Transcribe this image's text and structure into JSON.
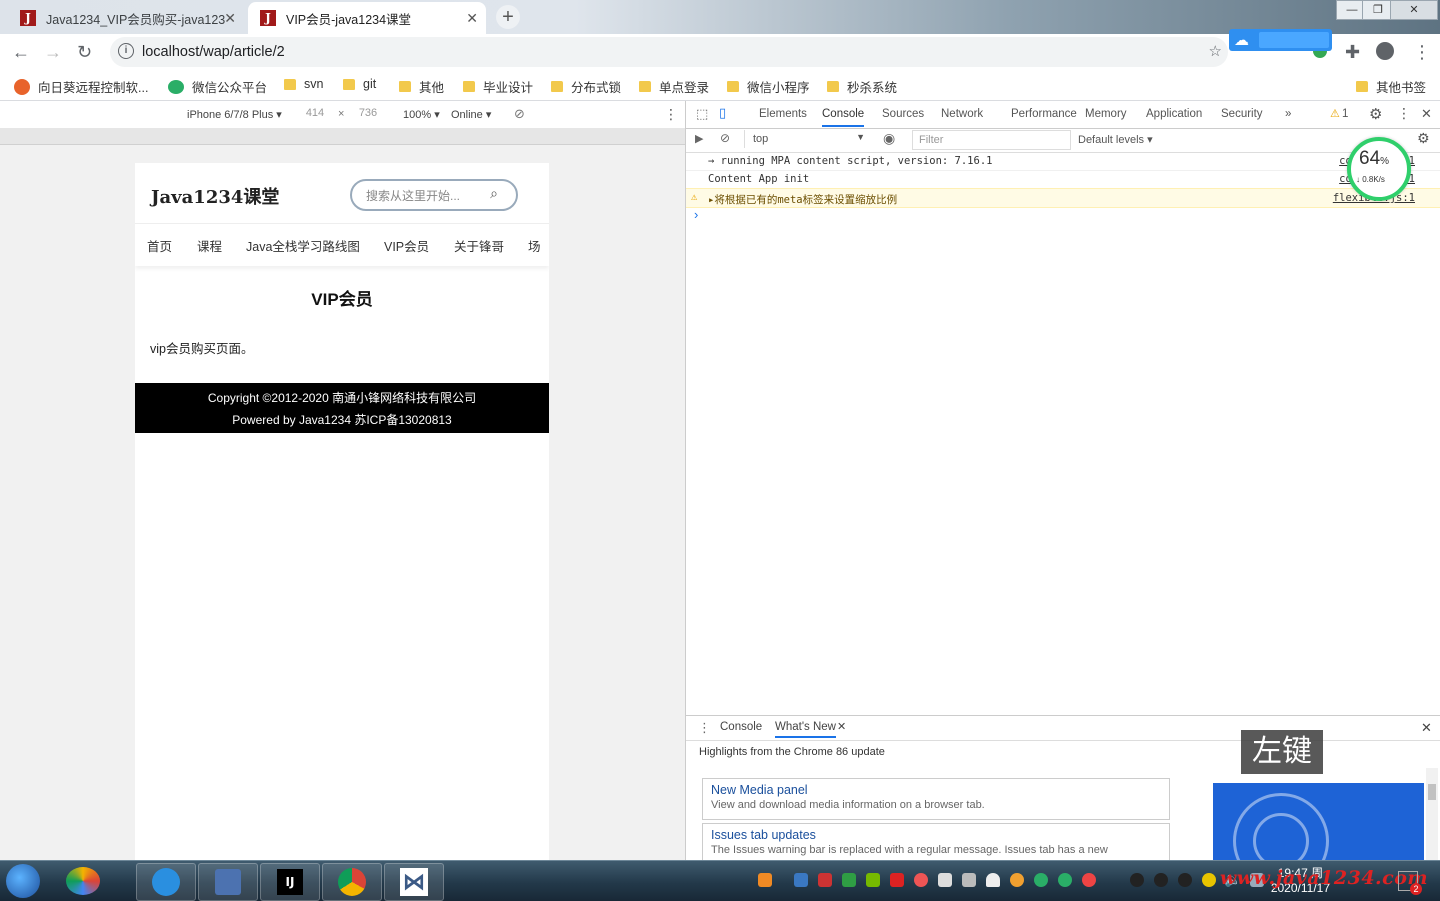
{
  "browser": {
    "tabs": [
      {
        "label": "Java1234_VIP会员购买-java123",
        "favicon": "J"
      },
      {
        "label": "VIP会员-java1234课堂",
        "favicon": "J"
      }
    ],
    "url": "localhost/wap/article/2",
    "bookmarks": [
      "向日葵远程控制软...",
      "微信公众平台",
      "svn",
      "git",
      "其他",
      "毕业设计",
      "分布式锁",
      "单点登录",
      "微信小程序",
      "秒杀系统"
    ],
    "other_bookmarks": "其他书签"
  },
  "device_toolbar": {
    "device": "iPhone 6/7/8 Plus ▾",
    "width": "414",
    "times": "×",
    "height": "736",
    "zoom": "100% ▾",
    "network": "Online ▾"
  },
  "mobile_page": {
    "site_title": "Java1234课堂",
    "search_placeholder": "搜索从这里开始...",
    "nav": [
      "首页",
      "课程",
      "Java全栈学习路线图",
      "VIP会员",
      "关于锋哥",
      "场"
    ],
    "article_title": "VIP会员",
    "article_body": "vip会员购买页面。",
    "footer_line1": "Copyright ©2012-2020 南通小锋网络科技有限公司",
    "footer_line2": "Powered by Java1234 苏ICP备13020813"
  },
  "devtools": {
    "tabs": [
      "Elements",
      "Console",
      "Sources",
      "Network",
      "Performance",
      "Memory",
      "Application",
      "Security",
      "»"
    ],
    "active_tab": "Console",
    "warning_count": "1",
    "context": "top",
    "filter_placeholder": "Filter",
    "levels": "Default levels ▾",
    "logs": [
      {
        "msg": "→ running MPA content script, version: 7.16.1",
        "src": "content...:1"
      },
      {
        "msg": "Content App init",
        "src": "content...:1"
      },
      {
        "msg": "▸将根据已有的meta标签来设置缩放比例",
        "src": "flexible.js:1"
      }
    ],
    "prompt": "›",
    "net_widget": {
      "percent": "64",
      "unit": "%",
      "speed": "↓ 0.8K/s"
    },
    "drawer": {
      "tabs": [
        "Console",
        "What's New"
      ],
      "active": "What's New",
      "heading": "Highlights from the Chrome 86 update",
      "cards": [
        {
          "title": "New Media panel",
          "desc": "View and download media information on a browser tab."
        },
        {
          "title": "Issues tab updates",
          "desc": "The Issues warning bar is replaced with a regular message. Issues tab has a new"
        }
      ]
    },
    "key_overlay": "左键"
  },
  "taskbar": {
    "time": "19:47 周",
    "date": "2020/11/17",
    "watermark": "www.java1234.com",
    "notify_badge": "2"
  },
  "colors": {
    "accent": "#1a73e8",
    "footer_bg": "#000000",
    "warn_bg": "#fffbe5",
    "net_ring": "#2fcf6b",
    "watermark": "#dd2222"
  }
}
